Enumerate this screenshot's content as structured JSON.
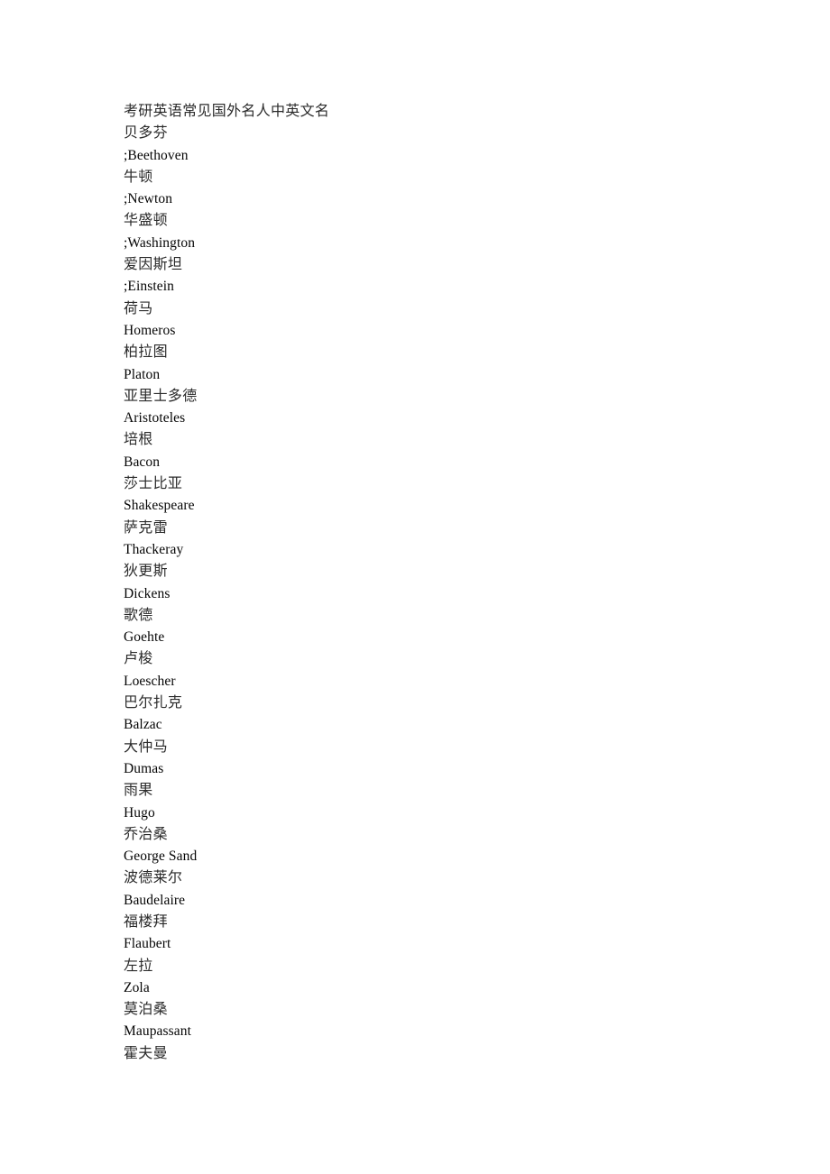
{
  "document": {
    "title": "考研英语常见国外名人中英文名",
    "page_background": "#ffffff",
    "text_color": "#000000",
    "lines": [
      {
        "text": "考研英语常见国外名人中英文名",
        "script": "title"
      },
      {
        "text": "贝多芬",
        "script": "cjk"
      },
      {
        "text": ";Beethoven",
        "script": "latin"
      },
      {
        "text": "牛顿",
        "script": "cjk"
      },
      {
        "text": ";Newton",
        "script": "latin"
      },
      {
        "text": "华盛顿",
        "script": "cjk"
      },
      {
        "text": ";Washington",
        "script": "latin"
      },
      {
        "text": "爱因斯坦",
        "script": "cjk"
      },
      {
        "text": ";Einstein",
        "script": "latin"
      },
      {
        "text": "荷马",
        "script": "cjk"
      },
      {
        "text": "Homeros",
        "script": "latin"
      },
      {
        "text": "柏拉图",
        "script": "cjk"
      },
      {
        "text": "Platon",
        "script": "latin"
      },
      {
        "text": "亚里士多德",
        "script": "cjk"
      },
      {
        "text": "Aristoteles",
        "script": "latin"
      },
      {
        "text": "培根",
        "script": "cjk"
      },
      {
        "text": "Bacon",
        "script": "latin"
      },
      {
        "text": "莎士比亚",
        "script": "cjk"
      },
      {
        "text": "Shakespeare",
        "script": "latin"
      },
      {
        "text": "萨克雷",
        "script": "cjk"
      },
      {
        "text": "Thackeray",
        "script": "latin"
      },
      {
        "text": "狄更斯",
        "script": "cjk"
      },
      {
        "text": "Dickens",
        "script": "latin"
      },
      {
        "text": "歌德",
        "script": "cjk"
      },
      {
        "text": "Goehte",
        "script": "latin"
      },
      {
        "text": "卢梭",
        "script": "cjk"
      },
      {
        "text": "Loescher",
        "script": "latin"
      },
      {
        "text": "巴尔扎克",
        "script": "cjk"
      },
      {
        "text": "Balzac",
        "script": "latin"
      },
      {
        "text": "大仲马",
        "script": "cjk"
      },
      {
        "text": "Dumas",
        "script": "latin"
      },
      {
        "text": "雨果",
        "script": "cjk"
      },
      {
        "text": "Hugo",
        "script": "latin"
      },
      {
        "text": "乔治桑",
        "script": "cjk"
      },
      {
        "text": "George Sand",
        "script": "latin"
      },
      {
        "text": "波德莱尔",
        "script": "cjk"
      },
      {
        "text": "Baudelaire",
        "script": "latin"
      },
      {
        "text": "福楼拜",
        "script": "cjk"
      },
      {
        "text": "Flaubert",
        "script": "latin"
      },
      {
        "text": "左拉",
        "script": "cjk"
      },
      {
        "text": "Zola",
        "script": "latin"
      },
      {
        "text": "莫泊桑",
        "script": "cjk"
      },
      {
        "text": "Maupassant",
        "script": "latin"
      },
      {
        "text": "霍夫曼",
        "script": "cjk"
      }
    ]
  }
}
